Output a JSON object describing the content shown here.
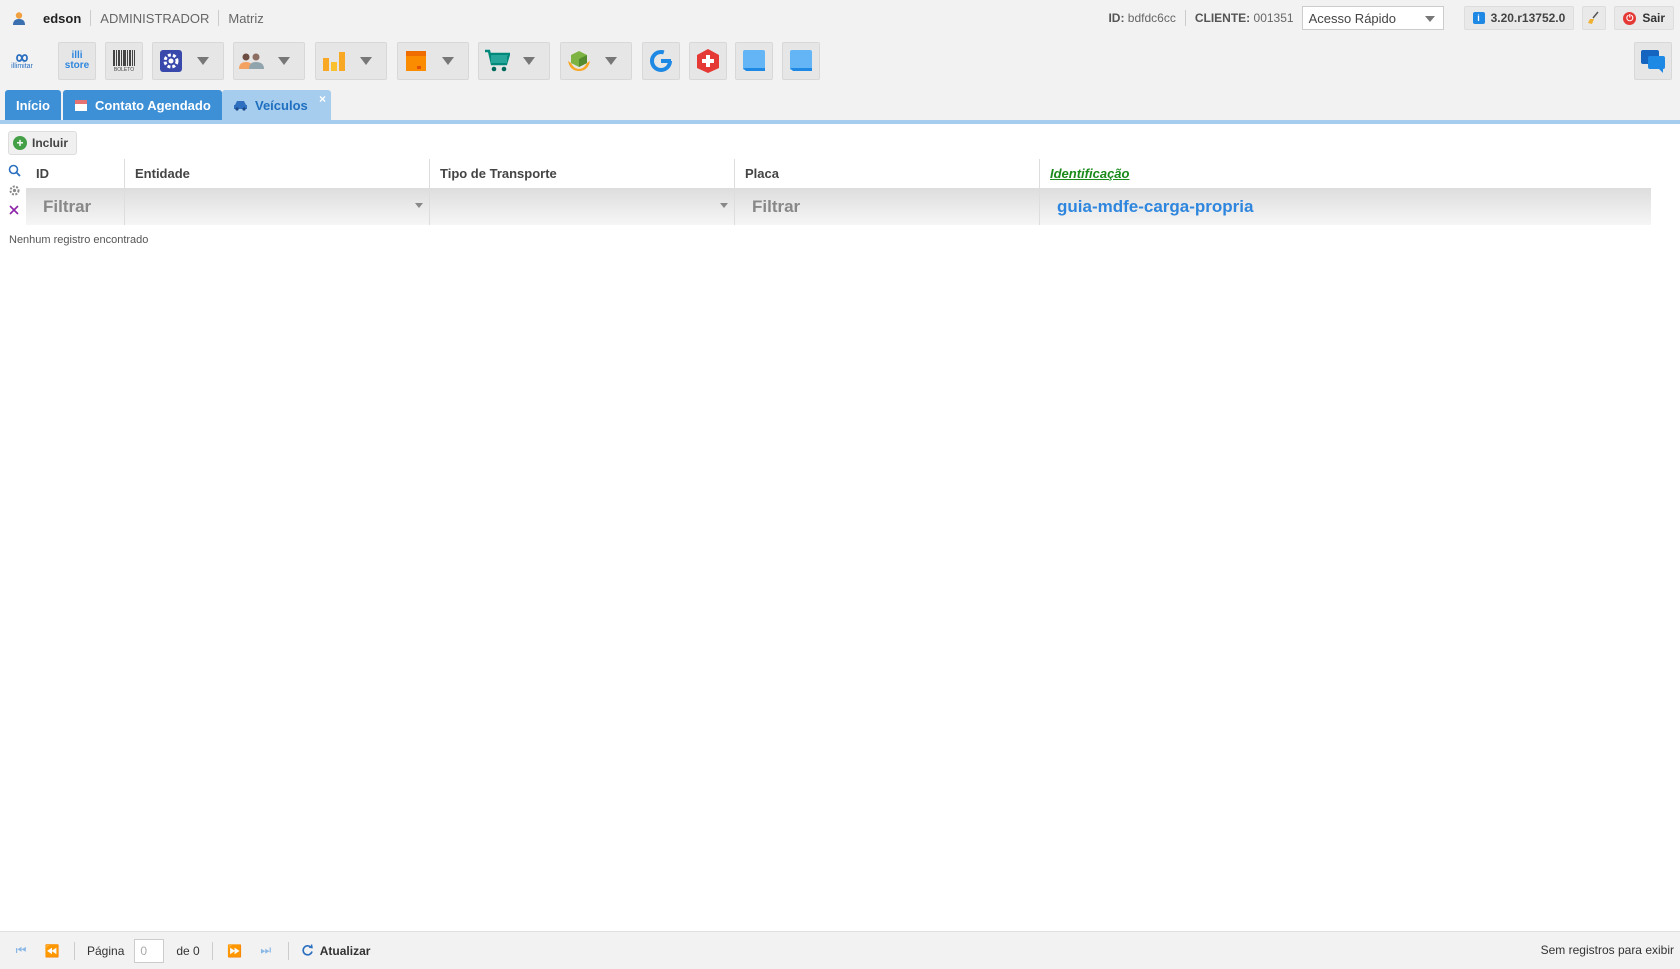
{
  "topbar": {
    "username": "edson",
    "role": "ADMINISTRADOR",
    "branch": "Matriz",
    "id_label": "ID:",
    "id_value": "bdfdc6cc",
    "client_label": "CLIENTE:",
    "client_value": "001351",
    "quick_access": "Acesso Rápido",
    "version": "3.20.r13752.0",
    "logout": "Sair"
  },
  "toolbar": {
    "illimitar_label": "illimitar",
    "store_label": "illi store",
    "boleto_label": "BOLETO",
    "icons": [
      "illimitar-logo",
      "illi-store",
      "boleto",
      "settings",
      "people",
      "chart",
      "box",
      "cart",
      "package-hands",
      "google",
      "first-aid",
      "note",
      "note2",
      "chat"
    ]
  },
  "tabs": [
    {
      "label": "Início"
    },
    {
      "label": "Contato Agendado"
    },
    {
      "label": "Veículos",
      "close": "×"
    }
  ],
  "actions": {
    "include": "Incluir"
  },
  "grid": {
    "columns": [
      "ID",
      "Entidade",
      "Tipo de Transporte",
      "Placa",
      "Identificação"
    ],
    "filter_placeholder": "Filtrar",
    "identification_filter": "guia-mdfe-carga-propria",
    "empty_message": "Nenhum registro encontrado"
  },
  "footer": {
    "page_label": "Página",
    "page_value": "0",
    "of_label": "de 0",
    "refresh": "Atualizar",
    "status": "Sem registros para exibir"
  },
  "colors": {
    "tab_blue": "#3d8fd6",
    "tab_active": "#a7cdee",
    "ident_green": "#1a8a1a",
    "link_blue": "#2e86de"
  }
}
